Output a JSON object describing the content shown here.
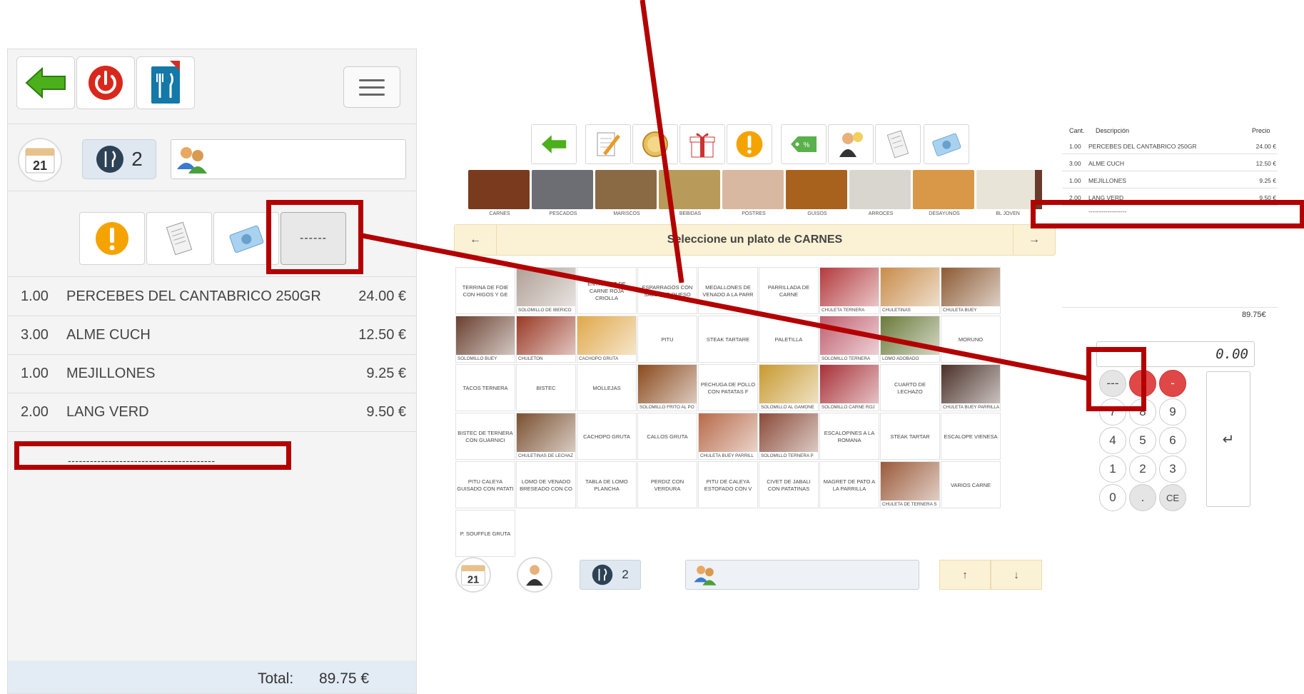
{
  "mobile": {
    "toolbar": {
      "back_icon": "arrow-left-icon",
      "power_icon": "power-icon",
      "menu_icon": "fork-knife-icon",
      "hamburger_icon": "hamburger-icon"
    },
    "table_number": "21",
    "covers": "2",
    "actions": {
      "dash_label": "------"
    },
    "lines": [
      {
        "qty": "1.00",
        "desc": "PERCEBES DEL CANTABRICO 250GR",
        "price": "24.00 €"
      },
      {
        "qty": "3.00",
        "desc": "ALME CUCH",
        "price": "12.50 €"
      },
      {
        "qty": "1.00",
        "desc": "MEJILLONES",
        "price": "9.25 €"
      },
      {
        "qty": "2.00",
        "desc": "LANG VERD",
        "price": "9.50 €"
      }
    ],
    "dash_line": "----------------------------------------",
    "total_label": "Total:",
    "total_value": "89.75 €"
  },
  "desktop": {
    "categories": [
      {
        "label": "CARNES",
        "color": "#7a3a1e"
      },
      {
        "label": "PESCADOS",
        "color": "#6c6e74"
      },
      {
        "label": "MARISCOS",
        "color": "#8a6a44"
      },
      {
        "label": "BEBIDAS",
        "color": "#b89a5a"
      },
      {
        "label": "POSTRES",
        "color": "#d8b8a0"
      },
      {
        "label": "GUISOS",
        "color": "#a8621e"
      },
      {
        "label": "ARROCES",
        "color": "#d9d6d0"
      },
      {
        "label": "DESAYUNOS",
        "color": "#d89848"
      },
      {
        "label": "BL JOVEN",
        "color": "#e8e4d8"
      }
    ],
    "nav_title": "Seleccione un plato de CARNES",
    "nav_prev": "←",
    "nav_next": "→",
    "dishes": [
      {
        "text": "TERRINA DE FOIE CON HIGOS Y GE"
      },
      {
        "cap": "SOLOMILLO DE IBERICO",
        "color": "#b0a096"
      },
      {
        "text": "ENTRECOT DE CARNE ROJA CRIOLLA"
      },
      {
        "text": "ESPARRAGOS CON SALSA DE QUESO"
      },
      {
        "text": "MEDALLONES DE VENADO A LA PARR"
      },
      {
        "text": "PARRILLADA DE CARNE"
      },
      {
        "cap": "CHULETA TERNERA",
        "color": "#b43a3e"
      },
      {
        "cap": "CHULETINAS",
        "color": "#c88c4a"
      },
      {
        "cap": "CHULETA BUEY",
        "color": "#8c5a34"
      },
      {
        "cap": "SOLOMILLO BUEY",
        "color": "#6a4030"
      },
      {
        "cap": "CHULETON",
        "color": "#9a3a26"
      },
      {
        "cap": "CACHOPO GRUTA",
        "color": "#e0a84a"
      },
      {
        "text": "PITU"
      },
      {
        "text": "STEAK TARTARE"
      },
      {
        "text": "PALETILLA"
      },
      {
        "cap": "SOLOMILLO TERNERA",
        "color": "#c06070"
      },
      {
        "cap": "LOMO ADOBADO",
        "color": "#6a7a3a"
      },
      {
        "text": "MORUNO"
      },
      {
        "text": "TACOS TERNERA"
      },
      {
        "text": "BISTEC"
      },
      {
        "text": "MOLLEJAS"
      },
      {
        "cap": "SOLOMILLO FRITO AL PO",
        "color": "#8a4a1e"
      },
      {
        "text": "PECHUGA DE POLLO CON PATATAS F"
      },
      {
        "cap": "SOLOMILLO AL GAMONE",
        "color": "#c89a30"
      },
      {
        "cap": "SOLOMILLO CARNE ROJ",
        "color": "#a83038"
      },
      {
        "text": "CUARTO DE LECHAZO"
      },
      {
        "cap": "CHULETA BUEY PARRILLA S/P",
        "color": "#4a3028"
      },
      {
        "text": "BISTEC DE TERNERA CON GUARNICI"
      },
      {
        "cap": "CHULETINAS DE LECHAZ",
        "color": "#7a5030"
      },
      {
        "text": "CACHOPO GRUTA"
      },
      {
        "text": "CALLOS GRUTA"
      },
      {
        "cap": "CHULETA BUEY PARRILL",
        "color": "#b86a4a"
      },
      {
        "cap": "SOLOMILLO TERNERA P",
        "color": "#8a4a38"
      },
      {
        "text": "ESCALOPINES A LA ROMANA"
      },
      {
        "text": "STEAK TARTAR"
      },
      {
        "text": "ESCALOPE VIENESA"
      },
      {
        "text": "PITU CALEYA GUISADO CON PATATI"
      },
      {
        "text": "LOMO DE VENADO BRESEADO CON CO"
      },
      {
        "text": "TABLA DE LOMO PLANCHA"
      },
      {
        "text": "PERDIZ CON VERDURA"
      },
      {
        "text": "PITU DE CALEYA ESTOFADO CON V"
      },
      {
        "text": "CIVET DE JABALI CON PATATINAS"
      },
      {
        "text": "MAGRET DE PATO A LA PARRILLA"
      },
      {
        "cap": "CHULETA DE TERNERA S",
        "color": "#9a5a3a"
      },
      {
        "text": "VARIOS CARNE"
      },
      {
        "text": "P. SOUFFLE GRUTA"
      }
    ],
    "bottom": {
      "table_number": "21",
      "covers": "2",
      "up": "↑",
      "down": "↓"
    },
    "receipt": {
      "headers": {
        "qty": "Cant.",
        "desc": "Descripción",
        "price": "Precio"
      },
      "rows": [
        {
          "qty": "1.00",
          "desc": "PERCEBES DEL CANTABRICO 250GR",
          "price": "24.00 €"
        },
        {
          "qty": "3.00",
          "desc": "ALME CUCH",
          "price": "12.50 €"
        },
        {
          "qty": "1.00",
          "desc": "MEJILLONES",
          "price": "9.25 €"
        },
        {
          "qty": "2.00",
          "desc": "LANG VERD",
          "price": "9.50 €"
        }
      ],
      "dash_line": "--------------------",
      "total": "89.75€"
    },
    "keypad": {
      "display": "0.00",
      "keys": [
        "---",
        "-",
        "-",
        "7",
        "8",
        "9",
        "4",
        "5",
        "6",
        "1",
        "2",
        "3",
        "0",
        ".",
        "CE"
      ],
      "enter": "↵"
    }
  }
}
